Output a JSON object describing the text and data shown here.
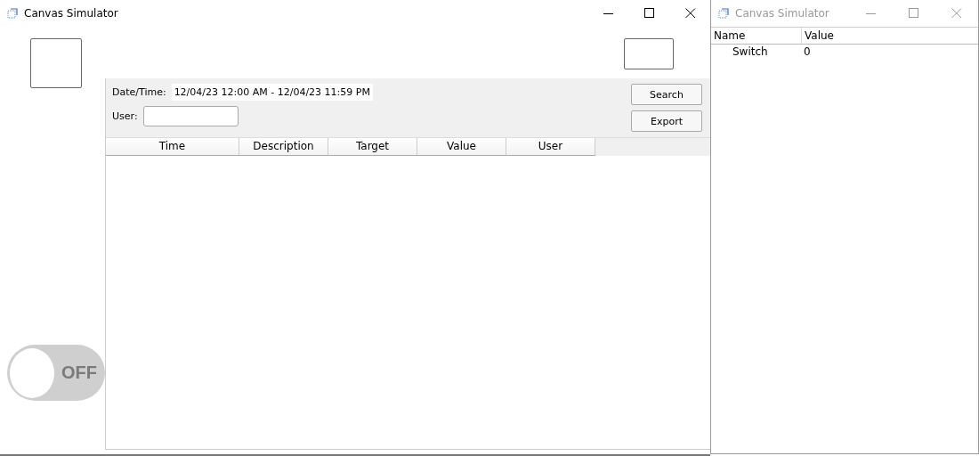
{
  "main_window": {
    "title": "Canvas Simulator",
    "active": true,
    "log_panel": {
      "date_label": "Date/Time:",
      "date_value": "12/04/23 12:00 AM - 12/04/23 11:59 PM",
      "user_label": "User:",
      "buttons": [
        "Search",
        "Export"
      ],
      "columns": [
        "Time",
        "Description",
        "Target",
        "Value",
        "User"
      ]
    },
    "toggle": {
      "on": false,
      "label": "OFF"
    }
  },
  "inspector_window": {
    "title": "Canvas Simulator",
    "active": false,
    "columns": [
      "Name",
      "Value"
    ],
    "rows": [
      {
        "name": "Switch",
        "value": "0"
      }
    ]
  }
}
